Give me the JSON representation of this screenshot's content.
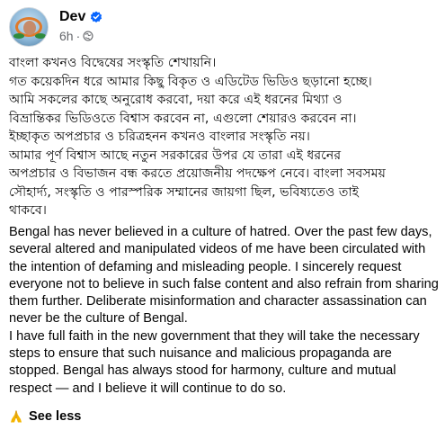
{
  "post": {
    "author": "Dev",
    "time": "6h",
    "dot": "·",
    "bengali_lines": [
      "বাংলা কখনও বিদ্বেষের সংস্কৃতি শেখায়নি।",
      "গত কয়েকদিন ধরে আমার কিছু বিকৃত ও এডিটেড ভিডিও ছড়ানো হচ্ছে।",
      "আমি সকলের কাছে অনুরোধ করবো, দয়া করে এই ধরনের মিথ্যা ও",
      "বিভ্রান্তিকর ভিডিওতে বিশ্বাস করবেন না, এগুলো শেয়ারও করবেন না।",
      "ইচ্ছাকৃত অপপ্রচার ও চরিত্রহনন কখনও বাংলার সংস্কৃতি নয়।",
      "আমার পূর্ণ বিশ্বাস আছে নতুন সরকারের উপর যে তারা এই ধরনের",
      "অপপ্রচার ও বিভাজন বন্ধ করতে প্রয়োজনীয় পদক্ষেপ নেবে। বাংলা সবসময়",
      "সৌহার্দ্য, সংস্কৃতি ও পারস্পরিক সম্মানের জায়গা ছিল, ভবিষ্যতেও তাই",
      "থাকবে।"
    ],
    "english_paragraph_1": "Bengal has never believed in a culture of hatred. Over the past few days, several altered and manipulated videos of me have been circulated with the intention of defaming and misleading people. I sincerely request everyone not to believe in such false content and also refrain from sharing them further. Deliberate misinformation and character assassination can never be the culture of Bengal.",
    "english_paragraph_2": "I have full faith in the new government that they will take the necessary steps to ensure that such nuisance and malicious propaganda are stopped. Bengal has always stood for harmony, culture and mutual respect — and I believe it will continue to do so.",
    "see_less": "See less"
  },
  "icons": {
    "verified": "verified-badge-icon",
    "audience": "globe-icon",
    "emoji": "folded-hands-icon"
  },
  "colors": {
    "verified_blue": "#0866ff",
    "meta_gray": "#65676b",
    "text": "#050505"
  }
}
